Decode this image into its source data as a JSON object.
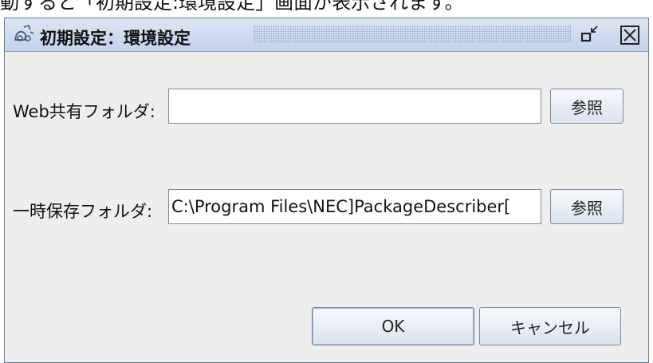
{
  "caption": {
    "text": "動すると「初期設定:環境設定」画面が表示されます。"
  },
  "window": {
    "title": "初期設定：環境設定"
  },
  "icons": {
    "app": "app-icon",
    "restore": "restore-icon",
    "close": "close-icon"
  },
  "form": {
    "web_shared_folder": {
      "label": "Web共有フォルダ:",
      "value": "",
      "browse_label": "参照"
    },
    "temp_folder": {
      "label": "一時保存フォルダ:",
      "value": "C:\\Program Files\\NEC]PackageDescriber[",
      "browse_label": "参照"
    }
  },
  "buttons": {
    "ok_label": "OK",
    "cancel_label": "キャンセル"
  },
  "colors": {
    "titlebar": "#c3d3ea",
    "window_bg": "#eeeeee",
    "border": "#6a7b94"
  }
}
